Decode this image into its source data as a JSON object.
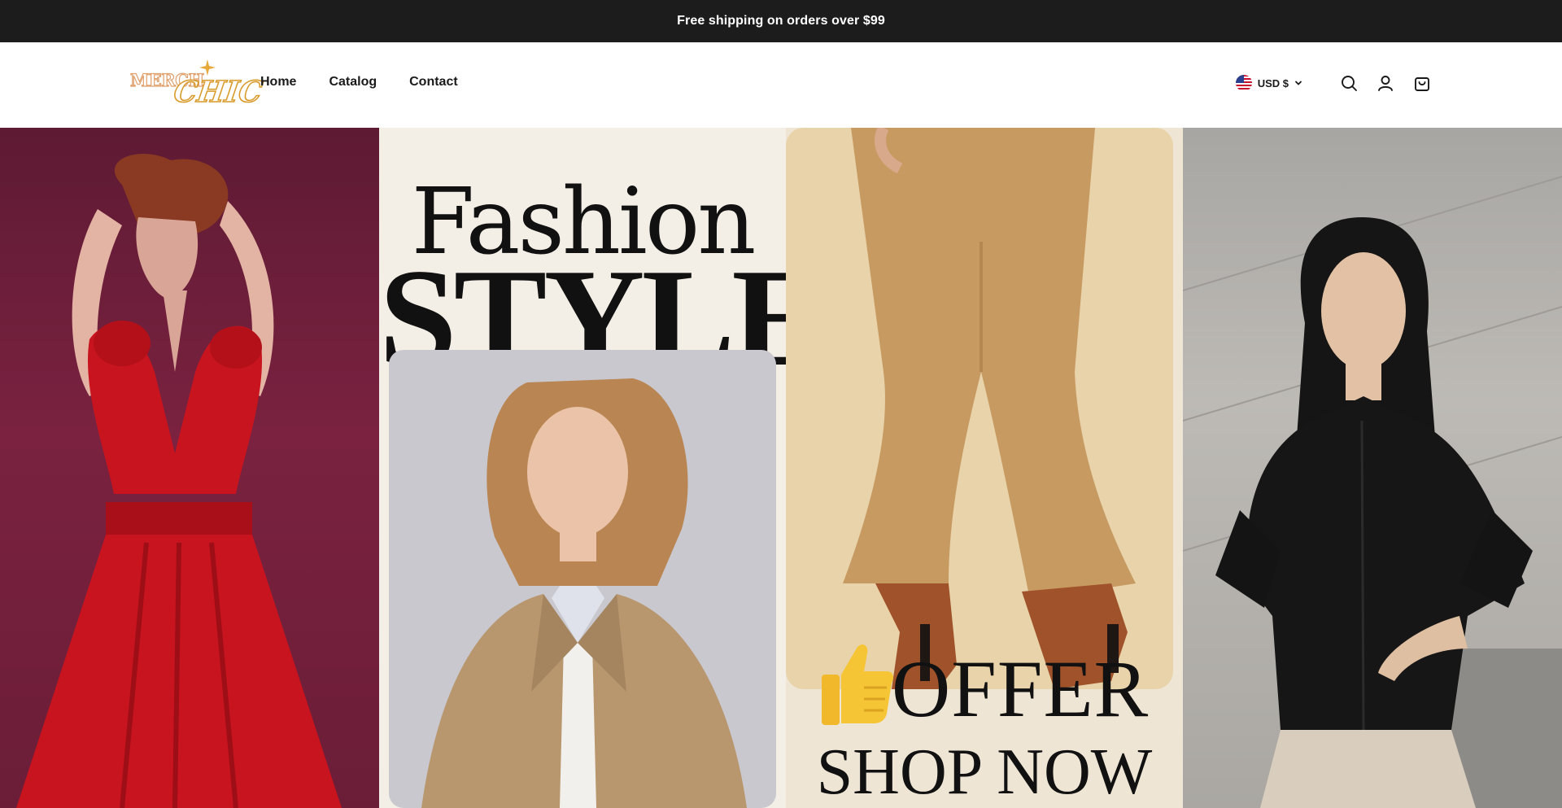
{
  "announcement": {
    "text": "Free shipping on orders over $99"
  },
  "header": {
    "logo": {
      "line1": "MERCH",
      "line2": "CHIC"
    },
    "nav": [
      {
        "label": "Home"
      },
      {
        "label": "Catalog"
      },
      {
        "label": "Contact"
      }
    ],
    "currency": {
      "label": "USD $",
      "flag_icon": "us-flag-icon"
    },
    "icons": [
      "search-icon",
      "account-icon",
      "cart-icon"
    ]
  },
  "hero": {
    "headline_1": "Fashion",
    "headline_2": "STYLE",
    "offer_text": "OFFER",
    "cta_text": "SHOP NOW",
    "offer_icon": "thumbs-up-icon",
    "images": [
      "woman-in-red-dress-photo",
      "woman-in-beige-blazer-photo",
      "flared-tan-pants-and-boots-photo",
      "woman-in-black-shirt-photo"
    ]
  },
  "colors": {
    "announcement_bg": "#1c1c1c",
    "logo_orange": "#e0a16e",
    "logo_gold": "#d89a2a",
    "text": "#1a1a1a"
  }
}
